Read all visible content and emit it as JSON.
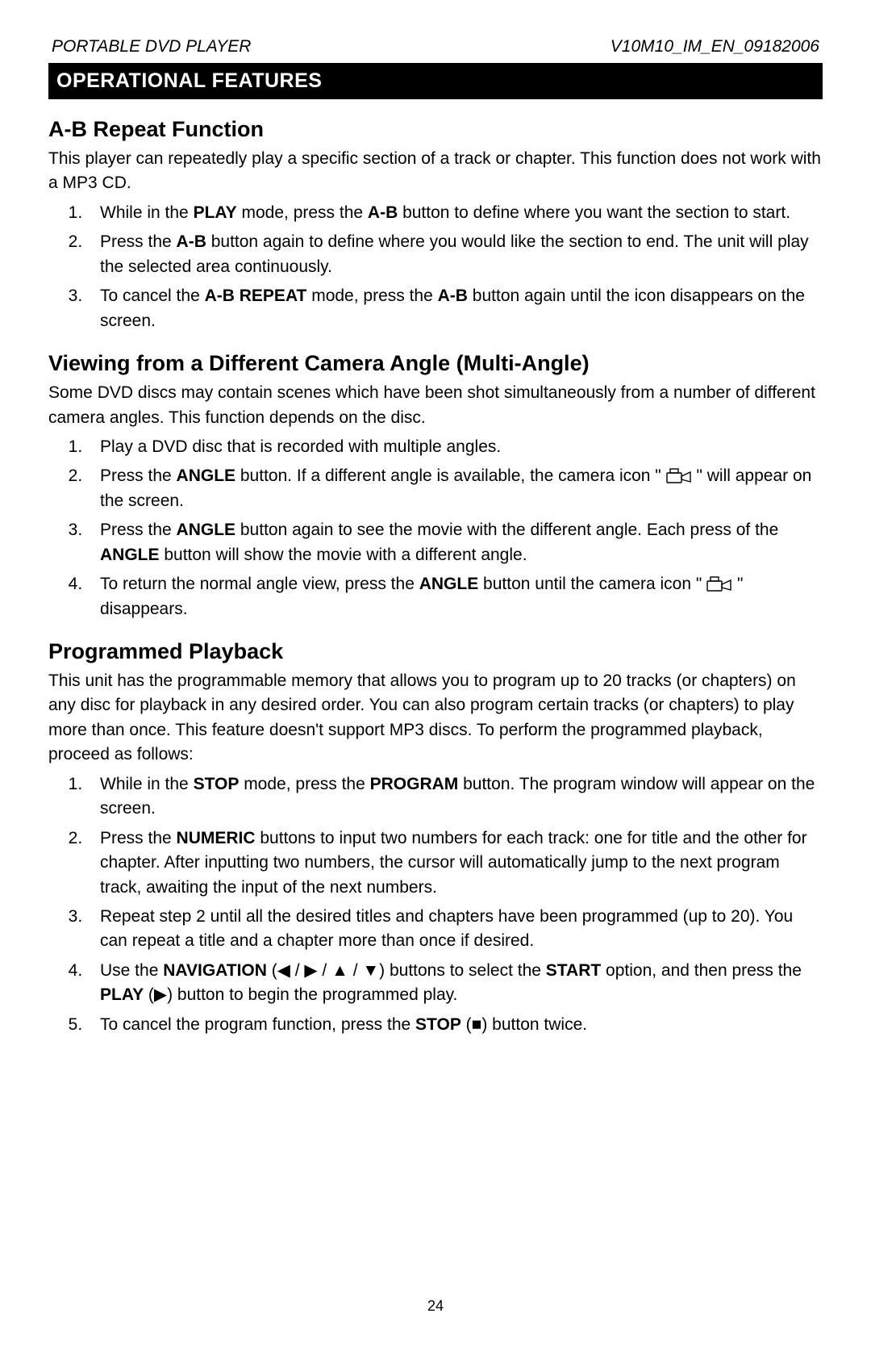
{
  "header": {
    "left": "PORTABLE DVD PLAYER",
    "right": "V10M10_IM_EN_09182006"
  },
  "sectionBar": "OPERATIONAL FEATURES",
  "ab": {
    "heading": "A-B Repeat Function",
    "intro": "This player can repeatedly play a specific section of a track or chapter. This function does not work with a MP3 CD.",
    "steps": {
      "s1a": "While in the ",
      "s1b": "PLAY",
      "s1c": " mode, press the ",
      "s1d": "A-B",
      "s1e": " button to define where you want the section to start.",
      "s2a": "Press the ",
      "s2b": "A-B",
      "s2c": " button again to define where you would like the section to end. The unit will play the selected area continuously.",
      "s3a": "To cancel the ",
      "s3b": "A-B REPEAT",
      "s3c": " mode, press the ",
      "s3d": "A-B",
      "s3e": " button again until the icon disappears on the screen."
    }
  },
  "angle": {
    "heading": "Viewing from a Different Camera Angle (Multi-Angle)",
    "intro": "Some DVD discs may contain scenes which have been shot simultaneously from a number of different camera angles. This function depends on the disc.",
    "steps": {
      "s1": "Play a DVD disc that is recorded with multiple angles.",
      "s2a": "Press the ",
      "s2b": "ANGLE",
      "s2c": " button. If a different angle is available, the camera icon \" ",
      "s2d": " \" will appear on the screen.",
      "s3a": "Press the ",
      "s3b": "ANGLE",
      "s3c": " button again to see the movie with the different angle. Each press of the ",
      "s3d": "ANGLE",
      "s3e": " button will show the movie with a different angle.",
      "s4a": "To return the normal angle view, press the ",
      "s4b": "ANGLE",
      "s4c": " button until the camera icon \" ",
      "s4d": " \" disappears."
    }
  },
  "prog": {
    "heading": "Programmed Playback",
    "intro": "This unit has the programmable memory that allows you to program up to 20 tracks (or chapters) on any disc for playback in any desired order. You can also program certain tracks (or chapters) to play more than once. This feature doesn't support MP3 discs. To perform the programmed playback, proceed as follows:",
    "steps": {
      "s1a": "While in the ",
      "s1b": "STOP",
      "s1c": " mode, press the ",
      "s1d": "PROGRAM",
      "s1e": " button. The program window will appear on the screen.",
      "s2a": "Press the ",
      "s2b": "NUMERIC",
      "s2c": " buttons to input two numbers for each track: one for title and the other for chapter. After inputting two numbers, the cursor will automatically jump to the next program track, awaiting the input of the next numbers.",
      "s3": "Repeat step 2 until all the desired titles and chapters have been programmed (up to 20). You can repeat a title and a chapter more than once if desired.",
      "s4a": "Use the ",
      "s4b": "NAVIGATION",
      "s4c": " (◀ / ▶ / ▲ / ▼) buttons to select the ",
      "s4d": "START",
      "s4e": " option, and then press the ",
      "s4f": "PLAY",
      "s4g": " (▶) button to begin the programmed play.",
      "s5a": "To cancel the program function, press the ",
      "s5b": "STOP",
      "s5c": " (■) button twice."
    }
  },
  "pageNumber": "24"
}
